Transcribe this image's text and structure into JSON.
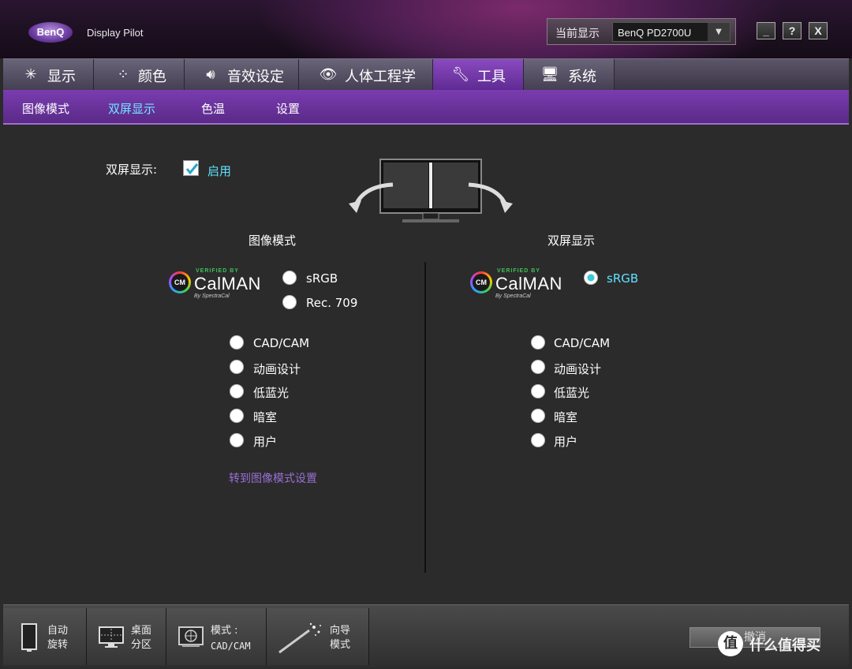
{
  "app": {
    "logo_text": "BenQ",
    "title": "Display Pilot"
  },
  "display_select": {
    "label": "当前显示",
    "value": "BenQ PD2700U"
  },
  "window_buttons": {
    "minimize": "_",
    "help": "?",
    "close": "X"
  },
  "tabs": [
    {
      "label": "显示",
      "icon": "brightness-icon"
    },
    {
      "label": "颜色",
      "icon": "color-dots-icon"
    },
    {
      "label": "音效设定",
      "icon": "speaker-icon"
    },
    {
      "label": "人体工程学",
      "icon": "eye-icon"
    },
    {
      "label": "工具",
      "icon": "wrench-icon",
      "active": true
    },
    {
      "label": "系统",
      "icon": "system-icon"
    }
  ],
  "subtabs": [
    {
      "label": "图像模式"
    },
    {
      "label": "双屏显示",
      "active": true
    },
    {
      "label": "色温"
    },
    {
      "label": "设置"
    }
  ],
  "dual_display": {
    "label": "双屏显示:",
    "enable_label": "启用",
    "enabled": true
  },
  "left_panel": {
    "heading": "图像模式",
    "calman": {
      "verified": "VERIFIED BY",
      "brand": "CalMAN",
      "by": "By SpectraCal",
      "badge": "CM"
    },
    "calman_options": [
      "sRGB",
      "Rec. 709"
    ],
    "options": [
      "CAD/CAM",
      "动画设计",
      "低蓝光",
      "暗室",
      "用户"
    ],
    "link": "转到图像模式设置"
  },
  "right_panel": {
    "heading": "双屏显示",
    "calman": {
      "verified": "VERIFIED BY",
      "brand": "CalMAN",
      "by": "By SpectraCal",
      "badge": "CM"
    },
    "calman_options": [
      "sRGB"
    ],
    "selected": "sRGB",
    "options": [
      "CAD/CAM",
      "动画设计",
      "低蓝光",
      "暗室",
      "用户"
    ]
  },
  "bottom_buttons": [
    {
      "line1": "自动",
      "line2": "旋转",
      "icon": "rotate-monitor-icon"
    },
    {
      "line1": "桌面",
      "line2": "分区",
      "icon": "desktop-partition-icon"
    },
    {
      "line1": "模式 :",
      "line2": "CAD/CAM",
      "icon": "mode-icon"
    },
    {
      "line1": "向导",
      "line2": "模式",
      "icon": "wizard-wand-icon"
    }
  ],
  "cancel_label": "撤消",
  "watermark": "什么值得买",
  "watermark_badge": "值"
}
